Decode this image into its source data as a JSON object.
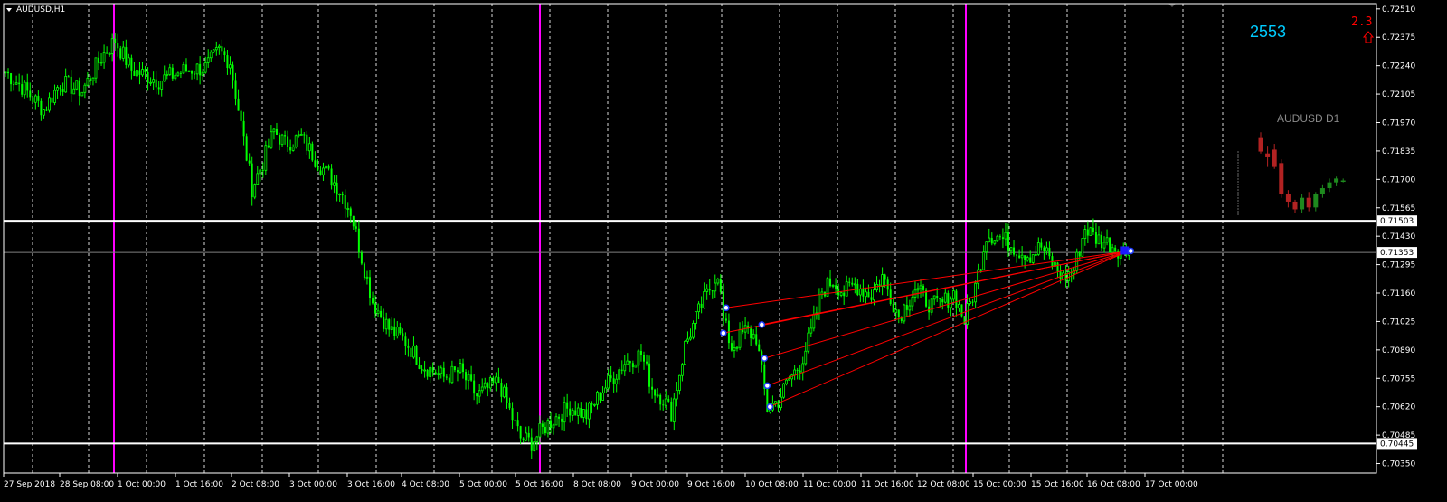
{
  "window": {
    "title": "AUDUSD,H1",
    "menu_icon": "triangle-down-icon"
  },
  "overlay": {
    "counter": "2553",
    "spread": "2.3",
    "spread_icon": "arrow-up-outline-icon",
    "d1_label": "AUDUSD D1"
  },
  "colors": {
    "background": "#000000",
    "candle": "#00ff00",
    "grid": "#ffffff",
    "session_line": "#ff00ff",
    "fan_line": "#ff0000",
    "counter": "#00ccff",
    "spread": "#ff0000",
    "bid_line": "#808080",
    "d1_bull": "#1e8a1e",
    "d1_bear": "#b22222"
  },
  "chart_data": {
    "type": "candlestick",
    "title": "AUDUSD,H1",
    "ylim": [
      0.70305,
      0.72535
    ],
    "y_ticks": [
      "0.72510",
      "0.72375",
      "0.72240",
      "0.72105",
      "0.71970",
      "0.71835",
      "0.71700",
      "0.71565",
      "0.71430",
      "0.71295",
      "0.71160",
      "0.71025",
      "0.70890",
      "0.70755",
      "0.70620",
      "0.70485",
      "0.70350"
    ],
    "x_ticks": [
      "27 Sep 2018",
      "28 Sep 08:00",
      "1 Oct 00:00",
      "1 Oct 16:00",
      "2 Oct 08:00",
      "3 Oct 00:00",
      "3 Oct 16:00",
      "4 Oct 08:00",
      "5 Oct 00:00",
      "5 Oct 16:00",
      "8 Oct 08:00",
      "9 Oct 00:00",
      "9 Oct 16:00",
      "10 Oct 08:00",
      "11 Oct 00:00",
      "11 Oct 16:00",
      "12 Oct 08:00",
      "15 Oct 00:00",
      "15 Oct 16:00",
      "16 Oct 08:00",
      "17 Oct 00:00"
    ],
    "grid": true,
    "horizontal_levels": [
      {
        "price": 0.71503,
        "label": "0.71503"
      },
      {
        "price": 0.70445,
        "label": "0.70445"
      }
    ],
    "bid": {
      "price": 0.71353,
      "label": "0.71353"
    },
    "session_separators": [
      "1 Oct 00:00",
      "8 Oct 00:00",
      "15 Oct 00:00"
    ],
    "close_path": [
      [
        0,
        0.7221
      ],
      [
        6,
        0.7214
      ],
      [
        14,
        0.7203
      ],
      [
        20,
        0.7216
      ],
      [
        28,
        0.7212
      ],
      [
        35,
        0.7228
      ],
      [
        40,
        0.7236
      ],
      [
        46,
        0.7222
      ],
      [
        56,
        0.7217
      ],
      [
        66,
        0.7222
      ],
      [
        73,
        0.7223
      ],
      [
        78,
        0.7231
      ],
      [
        82,
        0.7226
      ],
      [
        86,
        0.7196
      ],
      [
        90,
        0.7166
      ],
      [
        94,
        0.7178
      ],
      [
        98,
        0.7193
      ],
      [
        102,
        0.7187
      ],
      [
        108,
        0.719
      ],
      [
        114,
        0.7178
      ],
      [
        118,
        0.7172
      ],
      [
        122,
        0.7165
      ],
      [
        126,
        0.7155
      ],
      [
        130,
        0.7133
      ],
      [
        134,
        0.7112
      ],
      [
        140,
        0.7099
      ],
      [
        146,
        0.7093
      ],
      [
        152,
        0.7082
      ],
      [
        160,
        0.7076
      ],
      [
        166,
        0.7079
      ],
      [
        172,
        0.7067
      ],
      [
        180,
        0.7074
      ],
      [
        184,
        0.706
      ],
      [
        188,
        0.7047
      ],
      [
        192,
        0.7045
      ],
      [
        198,
        0.7054
      ],
      [
        206,
        0.7062
      ],
      [
        212,
        0.7058
      ],
      [
        218,
        0.707
      ],
      [
        226,
        0.7083
      ],
      [
        232,
        0.7087
      ],
      [
        236,
        0.7071
      ],
      [
        240,
        0.7066
      ],
      [
        243,
        0.7059
      ],
      [
        248,
        0.7091
      ],
      [
        254,
        0.711
      ],
      [
        260,
        0.7126
      ],
      [
        262,
        0.7103
      ],
      [
        265,
        0.709
      ],
      [
        270,
        0.7098
      ],
      [
        274,
        0.7095
      ],
      [
        278,
        0.7061
      ],
      [
        282,
        0.7065
      ],
      [
        286,
        0.7075
      ],
      [
        290,
        0.7082
      ],
      [
        294,
        0.7097
      ],
      [
        298,
        0.7117
      ],
      [
        302,
        0.7122
      ],
      [
        306,
        0.7116
      ],
      [
        310,
        0.712
      ],
      [
        316,
        0.7115
      ],
      [
        320,
        0.7124
      ],
      [
        326,
        0.7105
      ],
      [
        332,
        0.7118
      ],
      [
        338,
        0.711
      ],
      [
        342,
        0.7111
      ],
      [
        346,
        0.7116
      ],
      [
        350,
        0.7103
      ],
      [
        354,
        0.7119
      ],
      [
        358,
        0.7144
      ],
      [
        362,
        0.7143
      ],
      [
        366,
        0.714
      ],
      [
        370,
        0.7136
      ],
      [
        374,
        0.7134
      ],
      [
        378,
        0.7138
      ],
      [
        382,
        0.713
      ],
      [
        386,
        0.7123
      ],
      [
        390,
        0.7127
      ],
      [
        394,
        0.7147
      ],
      [
        398,
        0.7142
      ],
      [
        402,
        0.714
      ],
      [
        406,
        0.7137
      ],
      [
        410,
        0.7135
      ]
    ],
    "fan": {
      "apex": [
        410,
        0.7136
      ],
      "points": [
        [
          263,
          0.7109
        ],
        [
          262,
          0.7097
        ],
        [
          276,
          0.7101
        ],
        [
          277,
          0.7085
        ],
        [
          278,
          0.7072
        ],
        [
          279,
          0.7062
        ]
      ]
    },
    "d1_candles": [
      {
        "o": 0.7191,
        "h": 0.7194,
        "l": 0.7183,
        "c": 0.7184
      },
      {
        "o": 0.7183,
        "h": 0.7187,
        "l": 0.7176,
        "c": 0.7181
      },
      {
        "o": 0.7185,
        "h": 0.7188,
        "l": 0.7175,
        "c": 0.7176
      },
      {
        "o": 0.7178,
        "h": 0.718,
        "l": 0.716,
        "c": 0.7162
      },
      {
        "o": 0.7162,
        "h": 0.7164,
        "l": 0.7155,
        "c": 0.7158
      },
      {
        "o": 0.7158,
        "h": 0.7159,
        "l": 0.7152,
        "c": 0.7154
      },
      {
        "o": 0.7154,
        "h": 0.7162,
        "l": 0.7152,
        "c": 0.716
      },
      {
        "o": 0.716,
        "h": 0.7163,
        "l": 0.7153,
        "c": 0.7155
      },
      {
        "o": 0.7155,
        "h": 0.7163,
        "l": 0.7153,
        "c": 0.7162
      },
      {
        "o": 0.7162,
        "h": 0.7167,
        "l": 0.716,
        "c": 0.7165
      },
      {
        "o": 0.7165,
        "h": 0.717,
        "l": 0.7163,
        "c": 0.7168
      },
      {
        "o": 0.7168,
        "h": 0.7171,
        "l": 0.7166,
        "c": 0.717
      },
      {
        "o": 0.7169,
        "h": 0.717,
        "l": 0.7168,
        "c": 0.7169
      }
    ]
  }
}
